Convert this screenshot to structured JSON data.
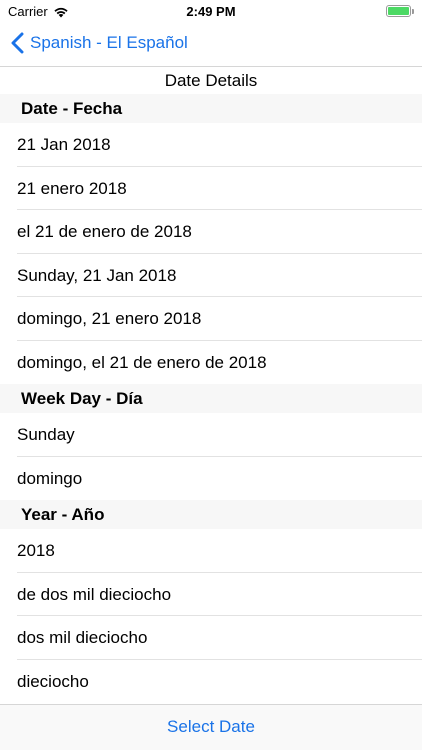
{
  "status_bar": {
    "carrier": "Carrier",
    "time": "2:49 PM",
    "battery_level": 1.0,
    "battery_color": "#4cd964"
  },
  "nav": {
    "back_label": "Spanish - El Español",
    "accent_color": "#1a73e8"
  },
  "title": "Date Details",
  "sections": {
    "date": {
      "header": "Date - Fecha",
      "rows": [
        "21 Jan 2018",
        "21 enero 2018",
        "el 21 de enero de 2018",
        "Sunday, 21 Jan 2018",
        "domingo, 21 enero 2018",
        "domingo, el 21 de enero de 2018"
      ]
    },
    "weekday": {
      "header": "Week Day - Día",
      "rows": [
        "Sunday",
        "domingo"
      ]
    },
    "year": {
      "header": "Year - Año",
      "rows": [
        "2018",
        "de dos mil dieciocho",
        "dos mil dieciocho",
        "dieciocho"
      ]
    }
  },
  "toolbar": {
    "select_date_label": "Select Date"
  }
}
